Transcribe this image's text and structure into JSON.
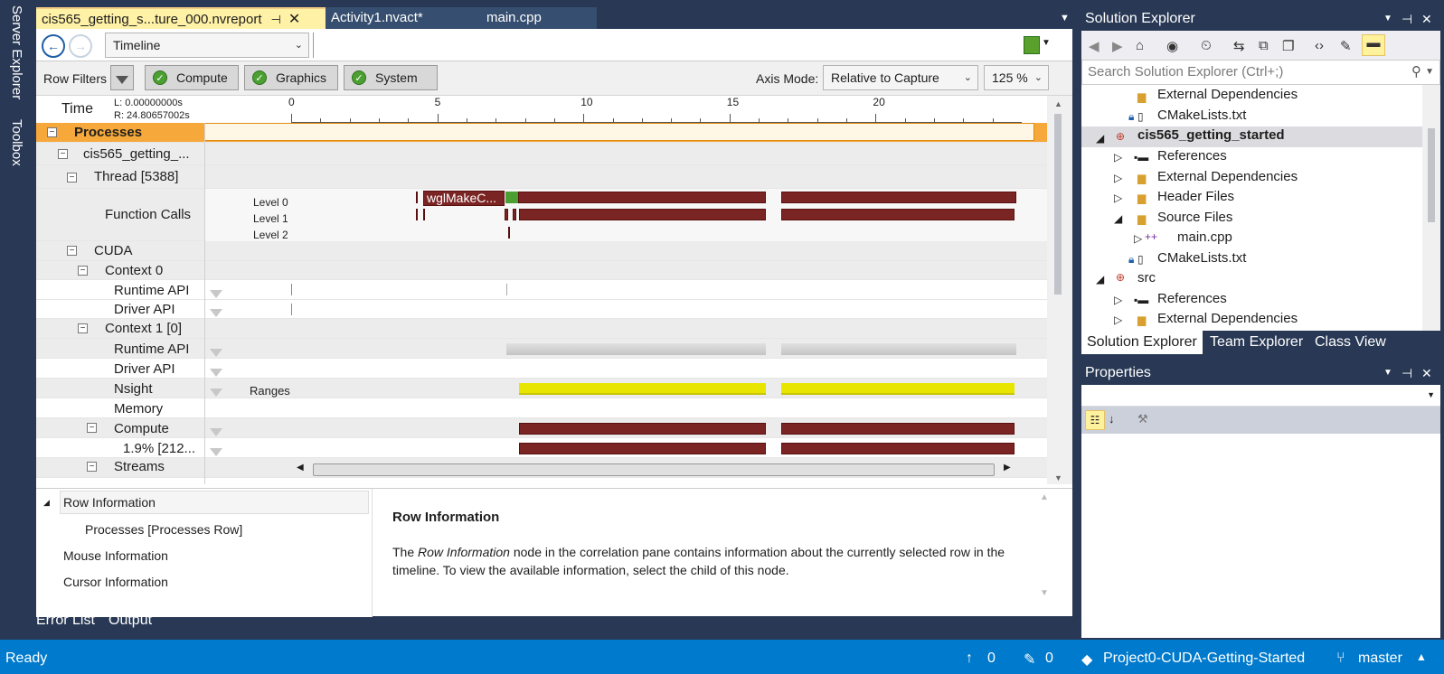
{
  "vertical_tabs": [
    "Server Explorer",
    "Toolbox"
  ],
  "doc_tabs": [
    {
      "label": "cis565_getting_s...ture_000.nvreport",
      "active": true
    },
    {
      "label": "Activity1.nvact*",
      "active": false
    },
    {
      "label": "main.cpp",
      "active": false
    }
  ],
  "toolbar": {
    "view_select": "Timeline"
  },
  "filters": {
    "label": "Row Filters",
    "buttons": [
      "Compute",
      "Graphics",
      "System"
    ],
    "axis_label": "Axis Mode:",
    "axis_value": "Relative to Capture",
    "zoom": "125 %"
  },
  "time": {
    "label": "Time",
    "l": "L: 0.00000000s",
    "r": "R: 24.80657002s",
    "ticks": [
      "0",
      "5",
      "10",
      "15",
      "20"
    ]
  },
  "rows": {
    "processes": "Processes",
    "process": "cis565_getting_...",
    "thread": "Thread [5388]",
    "function_calls": "Function Calls",
    "levels": [
      "Level 0",
      "Level 1",
      "Level 2"
    ],
    "wgl": "wglMakeC...",
    "cuda": "CUDA",
    "context0": "Context 0",
    "runtime_api": "Runtime API",
    "driver_api": "Driver API",
    "context1": "Context 1 [0]",
    "runtime_api2": "Runtime API",
    "driver_api2": "Driver API",
    "nsight": "Nsight",
    "ranges": "Ranges",
    "memory": "Memory",
    "compute": "Compute",
    "compute_pct": "1.9% [212...",
    "streams": "Streams"
  },
  "bottom": {
    "tree": [
      "Row Information",
      "Processes [Processes Row]",
      "Mouse Information",
      "Cursor Information"
    ],
    "info_title": "Row Information",
    "info_text_pre": "The ",
    "info_text_em": "Row Information",
    "info_text_post": " node in the correlation pane contains information about the currently selected row in the timeline. To view the available information, select the child of this node."
  },
  "bottom_tabs": [
    "Error List",
    "Output"
  ],
  "status": {
    "ready": "Ready",
    "up": "0",
    "edits": "0",
    "repo": "Project0-CUDA-Getting-Started",
    "branch": "master"
  },
  "solution_explorer": {
    "title": "Solution Explorer",
    "search_placeholder": "Search Solution Explorer (Ctrl+;)",
    "items": [
      "External Dependencies",
      "CMakeLists.txt",
      "cis565_getting_started",
      "References",
      "External Dependencies",
      "Header Files",
      "Source Files",
      "main.cpp",
      "CMakeLists.txt",
      "src",
      "References",
      "External Dependencies"
    ],
    "tabs": [
      "Solution Explorer",
      "Team Explorer",
      "Class View"
    ]
  },
  "properties": {
    "title": "Properties"
  },
  "colors": {
    "accent": "#007acc",
    "frame": "#293955",
    "tab_active": "#fff1a6",
    "red_bar": "#7b2424",
    "yellow_bar": "#e8e500"
  }
}
